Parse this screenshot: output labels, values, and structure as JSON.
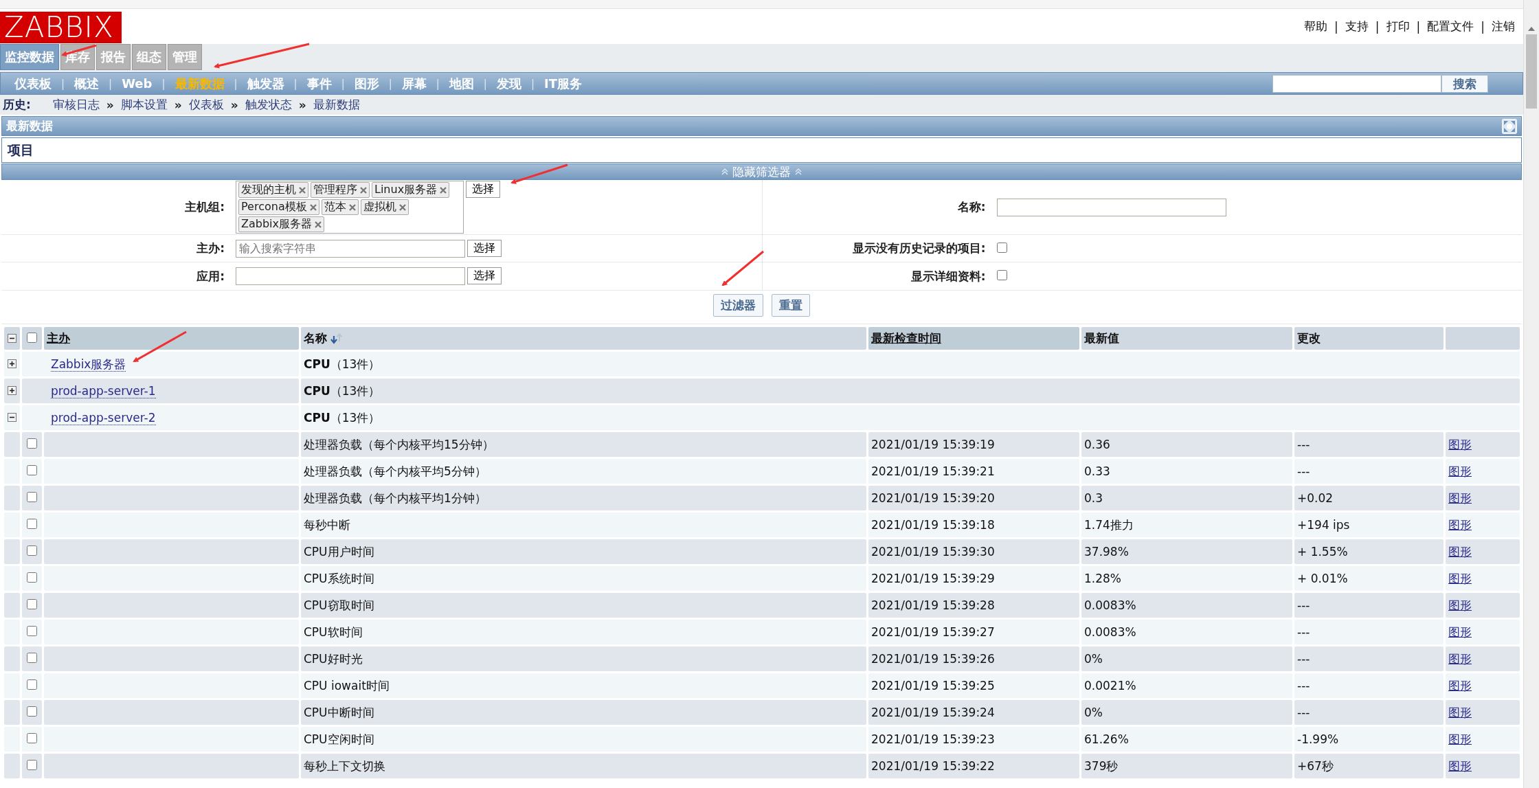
{
  "logo": "ZABBIX",
  "top_links": {
    "separator": "|",
    "items": [
      "帮助",
      "支持",
      "打印",
      "配置文件",
      "注销"
    ]
  },
  "main_tabs": [
    {
      "label": "监控数据",
      "selected": true
    },
    {
      "label": "库存",
      "selected": false
    },
    {
      "label": "报告",
      "selected": false
    },
    {
      "label": "组态",
      "selected": false
    },
    {
      "label": "管理",
      "selected": false
    }
  ],
  "sub_menu": {
    "separator": "|",
    "items": [
      {
        "label": "仪表板",
        "selected": false
      },
      {
        "label": "概述",
        "selected": false
      },
      {
        "label": "Web",
        "selected": false
      },
      {
        "label": "最新数据",
        "selected": true
      },
      {
        "label": "触发器",
        "selected": false
      },
      {
        "label": "事件",
        "selected": false
      },
      {
        "label": "图形",
        "selected": false
      },
      {
        "label": "屏幕",
        "selected": false
      },
      {
        "label": "地图",
        "selected": false
      },
      {
        "label": "发现",
        "selected": false
      },
      {
        "label": "IT服务",
        "selected": false
      }
    ]
  },
  "search": {
    "button": "搜索"
  },
  "history": {
    "label": "历史:",
    "separator": "»",
    "items": [
      "审核日志",
      "脚本设置",
      "仪表板",
      "触发状态",
      "最新数据"
    ]
  },
  "page_title": "最新数据",
  "section_title": "项目",
  "filter": {
    "toggle": "隐藏筛选器",
    "host_groups": {
      "label": "主机组:",
      "tags": [
        "发现的主机",
        "管理程序",
        "Linux服务器",
        "Percona模板",
        "范本",
        "虚拟机",
        "Zabbix服务器"
      ],
      "button": "选择"
    },
    "host": {
      "label": "主办:",
      "placeholder": "输入搜索字符串",
      "button": "选择"
    },
    "application": {
      "label": "应用:",
      "button": "选择"
    },
    "name": {
      "label": "名称:"
    },
    "show_without_data": {
      "label": "显示没有历史记录的项目:",
      "checked": false
    },
    "show_details": {
      "label": "显示详细资料:",
      "checked": false
    },
    "buttons": [
      "过滤器",
      "重置"
    ]
  },
  "table": {
    "select_all": false,
    "columns": [
      {
        "label": "主办",
        "sortable": true,
        "sorted": false
      },
      {
        "label": "名称",
        "sortable": false,
        "sorted": true
      },
      {
        "label": "最新检查时间",
        "sortable": true,
        "sorted": false
      },
      {
        "label": "最新值",
        "sortable": false,
        "sorted": false
      },
      {
        "label": "更改",
        "sortable": false,
        "sorted": false
      }
    ],
    "groups": [
      {
        "host": "Zabbix服务器",
        "application": "**CPU**（13件）",
        "expanded": false
      },
      {
        "host": "prod-app-server-1",
        "application": "**CPU**（13件）",
        "expanded": false
      },
      {
        "host": "prod-app-server-2",
        "application": "**CPU**（13件）",
        "expanded": true,
        "items": [
          {
            "name": "处理器负载（每个内核平均15分钟）",
            "time": "2021/01/19 15:39:19",
            "value": "0.36",
            "change": "---",
            "link": "图形",
            "checked": false
          },
          {
            "name": "处理器负载（每个内核平均5分钟）",
            "time": "2021/01/19 15:39:21",
            "value": "0.33",
            "change": "---",
            "link": "图形",
            "checked": false
          },
          {
            "name": "处理器负载（每个内核平均1分钟）",
            "time": "2021/01/19 15:39:20",
            "value": "0.3",
            "change": "+0.02",
            "link": "图形",
            "checked": false
          },
          {
            "name": "每秒中断",
            "time": "2021/01/19 15:39:18",
            "value": "1.74推力",
            "change": "+194 ips",
            "link": "图形",
            "checked": false
          },
          {
            "name": "CPU用户时间",
            "time": "2021/01/19 15:39:30",
            "value": "37.98%",
            "change": "+ 1.55%",
            "link": "图形",
            "checked": false
          },
          {
            "name": "CPU系统时间",
            "time": "2021/01/19 15:39:29",
            "value": "1.28%",
            "change": "+ 0.01%",
            "link": "图形",
            "checked": false
          },
          {
            "name": "CPU窃取时间",
            "time": "2021/01/19 15:39:28",
            "value": "0.0083%",
            "change": "---",
            "link": "图形",
            "checked": false
          },
          {
            "name": "CPU软时间",
            "time": "2021/01/19 15:39:27",
            "value": "0.0083%",
            "change": "---",
            "link": "图形",
            "checked": false
          },
          {
            "name": "CPU好时光",
            "time": "2021/01/19 15:39:26",
            "value": "0%",
            "change": "---",
            "link": "图形",
            "checked": false
          },
          {
            "name": "CPU iowait时间",
            "time": "2021/01/19 15:39:25",
            "value": "0.0021%",
            "change": "---",
            "link": "图形",
            "checked": false
          },
          {
            "name": "CPU中断时间",
            "time": "2021/01/19 15:39:24",
            "value": "0%",
            "change": "---",
            "link": "图形",
            "checked": false
          },
          {
            "name": "CPU空闲时间",
            "time": "2021/01/19 15:39:23",
            "value": "61.26%",
            "change": "-1.99%",
            "link": "图形",
            "checked": false
          },
          {
            "name": "每秒上下文切换",
            "time": "2021/01/19 15:39:22",
            "value": "379秒",
            "change": "+67秒",
            "link": "图形",
            "checked": false
          }
        ]
      }
    ]
  }
}
